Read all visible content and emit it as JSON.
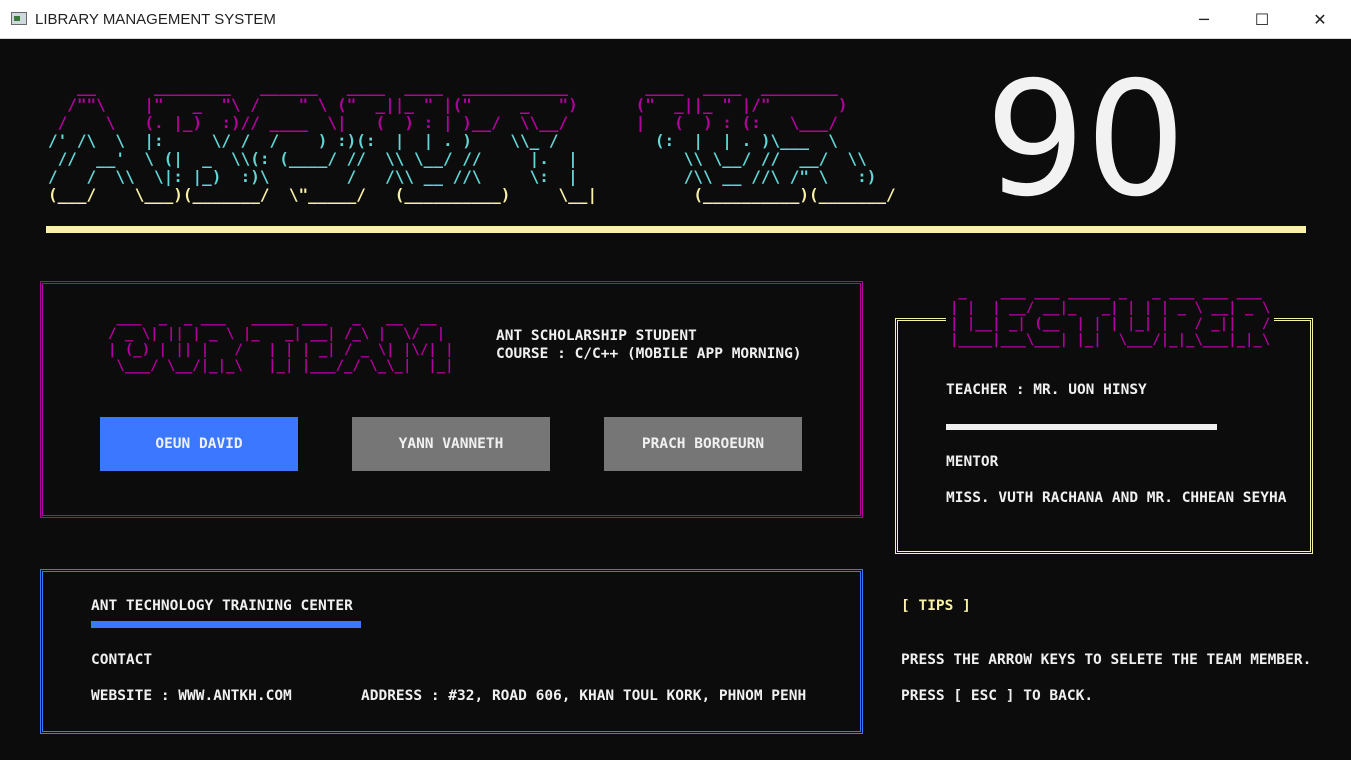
{
  "window": {
    "title": "LIBRARY MANAGEMENT SYSTEM",
    "minimize_glyph": "─",
    "maximize_glyph": "☐",
    "close_glyph": "✕"
  },
  "banner": {
    "ascii_pink": "   __      ________   ______   ____  ____  ___________        ____  ____  ________\n  /\"\"\\    |\"   _  \"\\ /    \" \\ (\"  _||_ \" |(\"     _   \")      (\"  _||_ \" |/\"       )\n /    \\   (. |_)  :)// ____  \\|   (  ) : | )__/  \\\\__/       |   (  ) : (:   \\___/",
    "ascii_cyan": "/' /\\  \\  |:     \\/ /  /    ) :)(:  |  | . )    \\\\_ /          (:  |  | . )\\___  \\\n //  __'  \\ (|  _  \\\\(: (____/ //  \\\\ \\__/ //     |.  |           \\\\ \\__/ //  __/  \\\\\n/   /  \\\\  \\|: |_)  :)\\        /   /\\\\ __ //\\     \\:  |           /\\\\ __ //\\ /\" \\   :)",
    "ascii_yellow": "(___/    \\___)(_______/  \\\"_____/   (__________)     \\__|          (__________)(_______/",
    "page_number": "90"
  },
  "team": {
    "ascii_pink": " ___  _  _ ___   _____ ___   _   __  __\n/ _ \\| || | _ \\ |_   _| __| /_\\ |  \\/  |\n| (_) | || |   /   | | | _| / _ \\| |\\/| |\n \\___/ \\__/|_|_\\   |_| |___/_/ \\_\\_|  |_|",
    "info_line1": "ANT SCHOLARSHIP STUDENT",
    "info_line2": "COURSE : C/C++ (MOBILE APP MORNING)",
    "members": [
      "OEUN DAVID",
      "YANN VANNETH",
      "PRACH BOROEURN"
    ]
  },
  "lecturer": {
    "ascii": " _    ___ ___ _____ _   _ ___ ___ ___\n| |  | __/ __|_   _| | | | _ \\ __| _ \\\n| |__| _| (__  | | | |_| |   / _||   /\n|____|___\\___| |_|  \\___/|_|_\\___|_|_\\",
    "teacher": "TEACHER : MR. UON HINSY",
    "mentor_label": "MENTOR",
    "mentors": "MISS. VUTH RACHANA AND MR. CHHEAN SEYHA"
  },
  "center": {
    "name": "ANT TECHNOLOGY TRAINING CENTER",
    "contact_label": "CONTACT",
    "website": "WEBSITE : WWW.ANTKH.COM",
    "address": "ADDRESS : #32, ROAD 606, KHAN TOUL KORK, PHNOM PENH"
  },
  "tips": {
    "label": "[ TIPS ]",
    "line1": "PRESS THE ARROW KEYS TO SELETE THE TEAM MEMBER.",
    "line2": "PRESS [ ESC ] TO BACK."
  },
  "colors": {
    "accent_pink": "#b4009e",
    "accent_cyan": "#61d6d6",
    "accent_yellow": "#f9f1a5",
    "selected_blue": "#3b78ff",
    "button_gray": "#767676",
    "background": "#0c0c0c"
  },
  "selected_member_index": 0
}
